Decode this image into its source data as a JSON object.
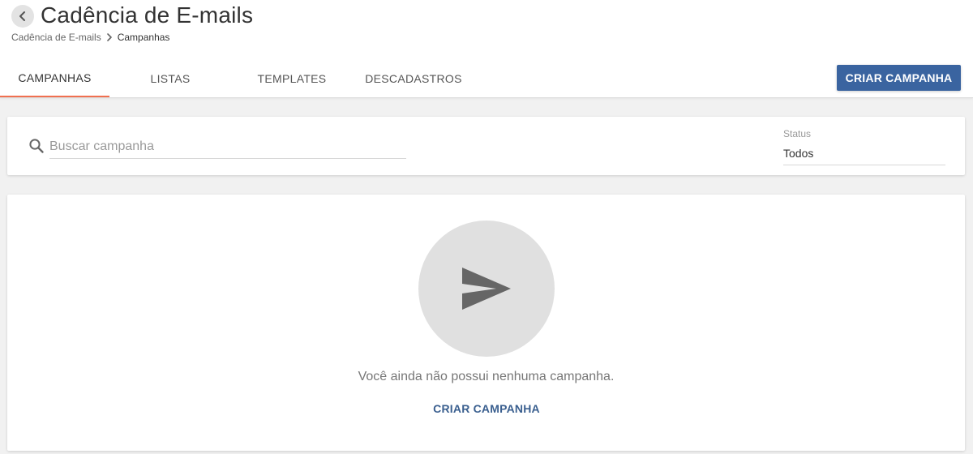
{
  "header": {
    "title": "Cadência de E-mails",
    "back_icon": "chevron-left-icon",
    "breadcrumb": {
      "items": [
        "Cadência de E-mails",
        "Campanhas"
      ],
      "separator_icon": "chevron-right-icon"
    }
  },
  "tabs": [
    {
      "label": "CAMPANHAS",
      "active": true
    },
    {
      "label": "LISTAS",
      "active": false
    },
    {
      "label": "TEMPLATES",
      "active": false
    },
    {
      "label": "DESCADASTROS",
      "active": false
    }
  ],
  "toolbar": {
    "create_label": "CRIAR CAMPANHA"
  },
  "filters": {
    "search_icon": "search-icon",
    "search_placeholder": "Buscar campanha",
    "search_value": "",
    "status_label": "Status",
    "status_value": "Todos"
  },
  "empty_state": {
    "icon": "send-icon",
    "message": "Você ainda não possui nenhuma campanha.",
    "action_label": "CRIAR CAMPANHA"
  },
  "colors": {
    "primary": "#3a64a0",
    "active_tab_underline": "#f07050",
    "empty_circle": "#e0e0e0",
    "send_icon": "#666666"
  }
}
